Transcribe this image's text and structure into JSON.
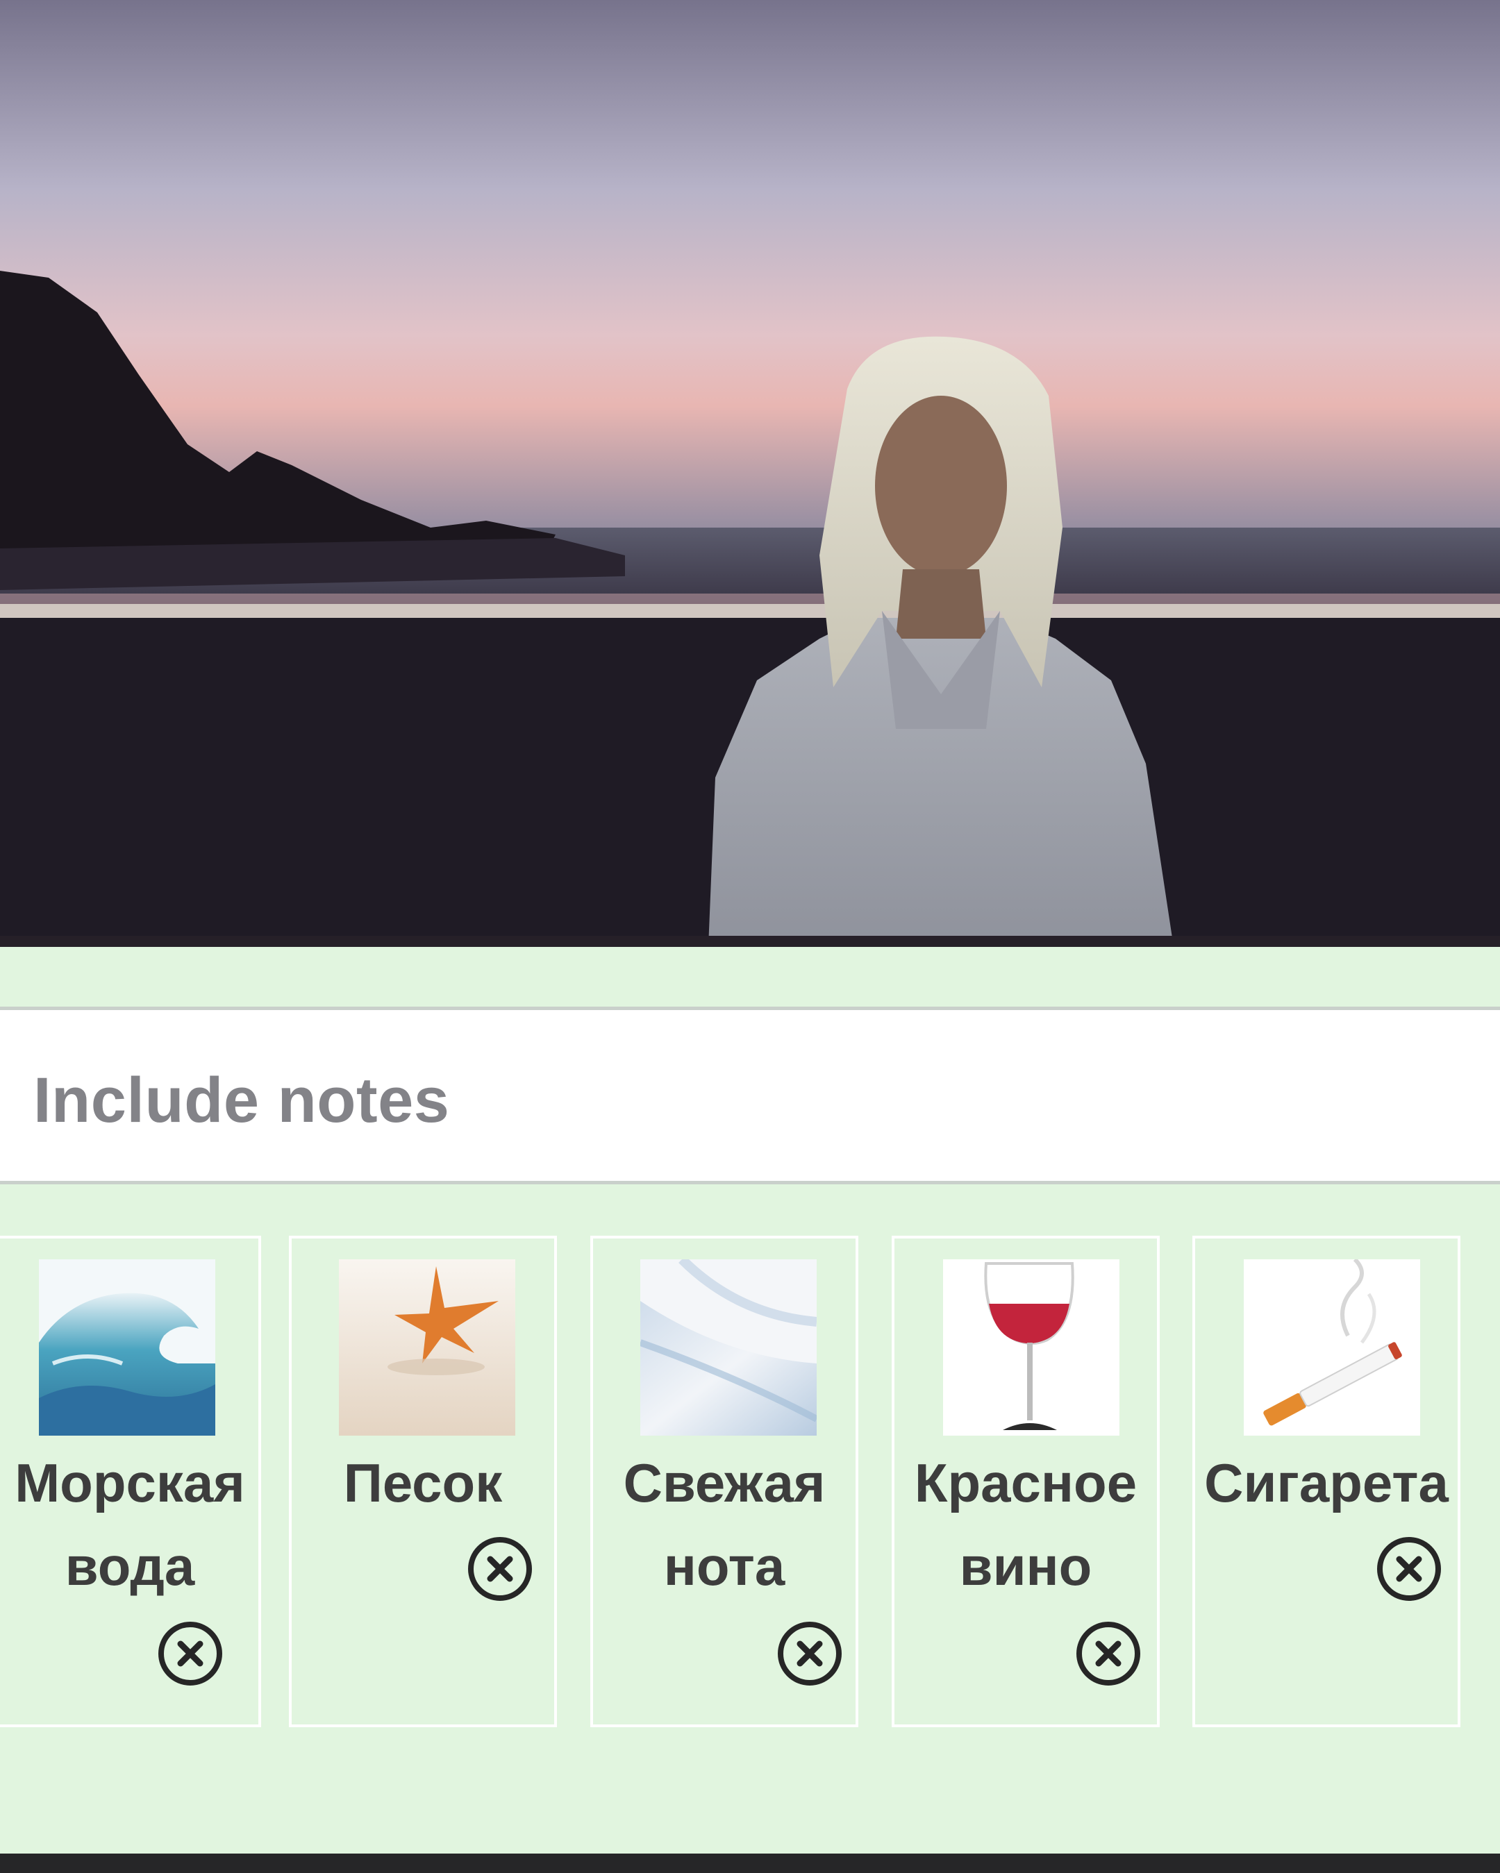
{
  "notes_section": {
    "placeholder": "Include notes"
  },
  "notes": [
    {
      "name_line1": "Морская",
      "name_line2": "вода",
      "icon": "ocean-wave-image"
    },
    {
      "name_line1": "Песок",
      "name_line2": "",
      "icon": "starfish-on-sand-image"
    },
    {
      "name_line1": "Свежая",
      "name_line2": "нота",
      "icon": "fresh-abstract-image"
    },
    {
      "name_line1": "Красное",
      "name_line2": "вино",
      "icon": "wine-glass-image"
    },
    {
      "name_line1": "Сигарета",
      "name_line2": "",
      "icon": "cigarette-image"
    }
  ],
  "colors": {
    "background": "#e1f5df",
    "card_border": "#ffffff",
    "text": "#3d3d3d",
    "placeholder": "#838388"
  }
}
